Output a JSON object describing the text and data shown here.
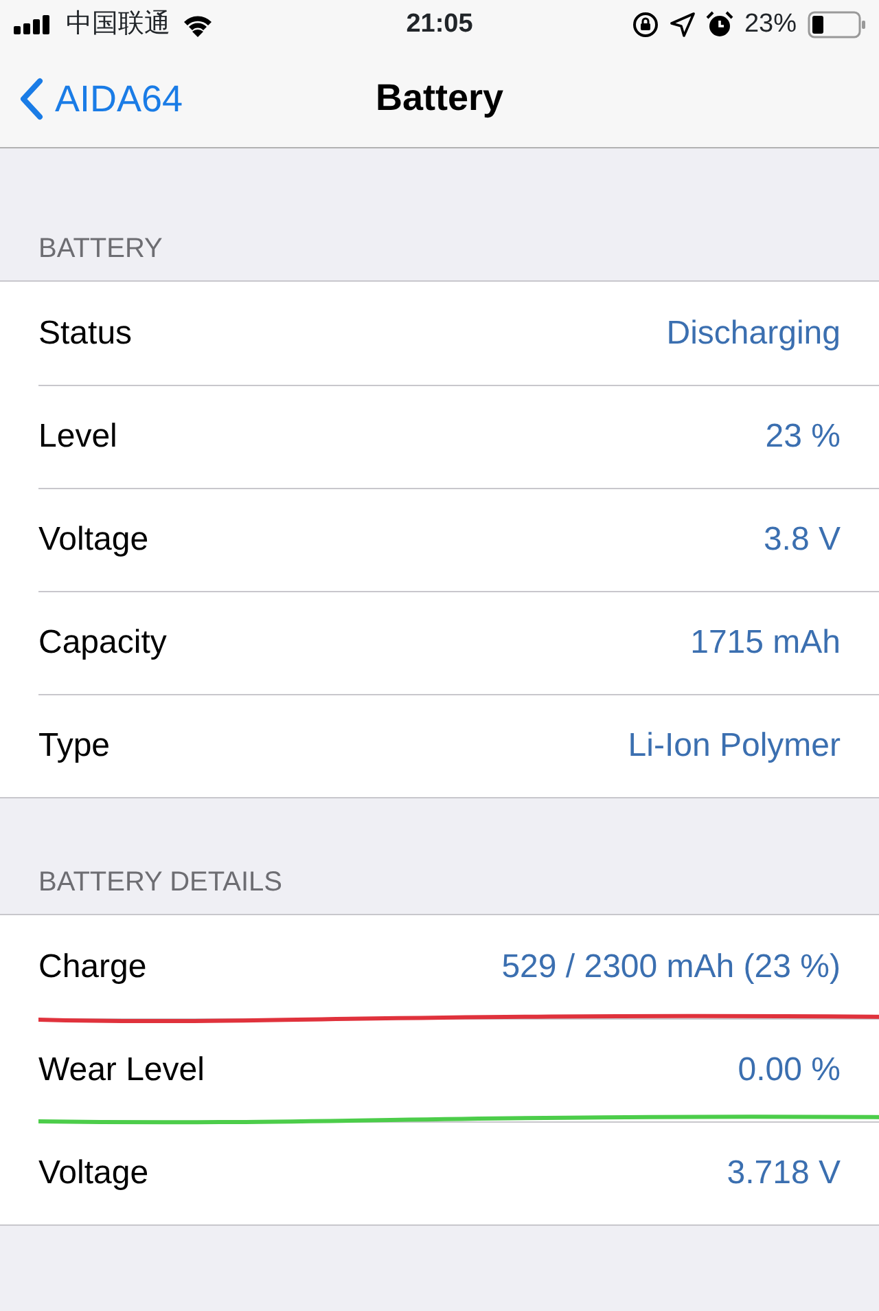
{
  "status_bar": {
    "carrier": "中国联通",
    "time": "21:05",
    "battery_percent": "23%"
  },
  "nav": {
    "back": "AIDA64",
    "title": "Battery"
  },
  "sections": [
    {
      "header": "BATTERY",
      "rows": [
        {
          "label": "Status",
          "value": "Discharging"
        },
        {
          "label": "Level",
          "value": "23 %"
        },
        {
          "label": "Voltage",
          "value": "3.8 V"
        },
        {
          "label": "Capacity",
          "value": "1715 mAh"
        },
        {
          "label": "Type",
          "value": "Li-Ion Polymer"
        }
      ]
    },
    {
      "header": "BATTERY DETAILS",
      "rows": [
        {
          "label": "Charge",
          "value": "529 / 2300 mAh (23 %)"
        },
        {
          "label": "Wear Level",
          "value": "0.00 %"
        },
        {
          "label": "Voltage",
          "value": "3.718 V"
        }
      ]
    }
  ]
}
